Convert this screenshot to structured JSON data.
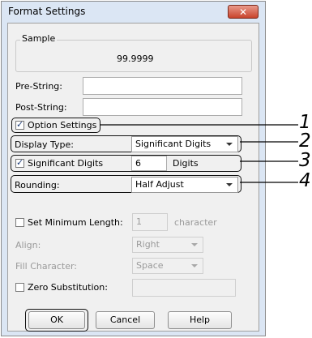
{
  "dialog": {
    "title": "Format Settings",
    "close_glyph": "✕"
  },
  "sample": {
    "label": "Sample",
    "value": "99.9999"
  },
  "pre_string": {
    "label": "Pre-String:",
    "value": ""
  },
  "post_string": {
    "label": "Post-String:",
    "value": ""
  },
  "option_settings": {
    "label": "Option Settings",
    "checked": true
  },
  "display_type": {
    "label": "Display Type:",
    "value": "Significant Digits"
  },
  "significant_digits": {
    "label": "Significant Digits",
    "checked": true,
    "value": "6",
    "unit": "Digits"
  },
  "rounding": {
    "label": "Rounding:",
    "value": "Half Adjust"
  },
  "min_length": {
    "label": "Set Minimum Length:",
    "checked": false,
    "value": "1",
    "unit": "character"
  },
  "align": {
    "label": "Align:",
    "value": "Right"
  },
  "fill_character": {
    "label": "Fill Character:",
    "value": "Space"
  },
  "zero_substitution": {
    "label": "Zero Substitution:",
    "checked": false,
    "value": ""
  },
  "buttons": {
    "ok": "OK",
    "cancel": "Cancel",
    "help": "Help"
  },
  "callouts": [
    "1",
    "2",
    "3",
    "4"
  ],
  "check_glyph": "✓",
  "icons": [
    "close-icon",
    "check-icon",
    "chevron-down-icon"
  ]
}
